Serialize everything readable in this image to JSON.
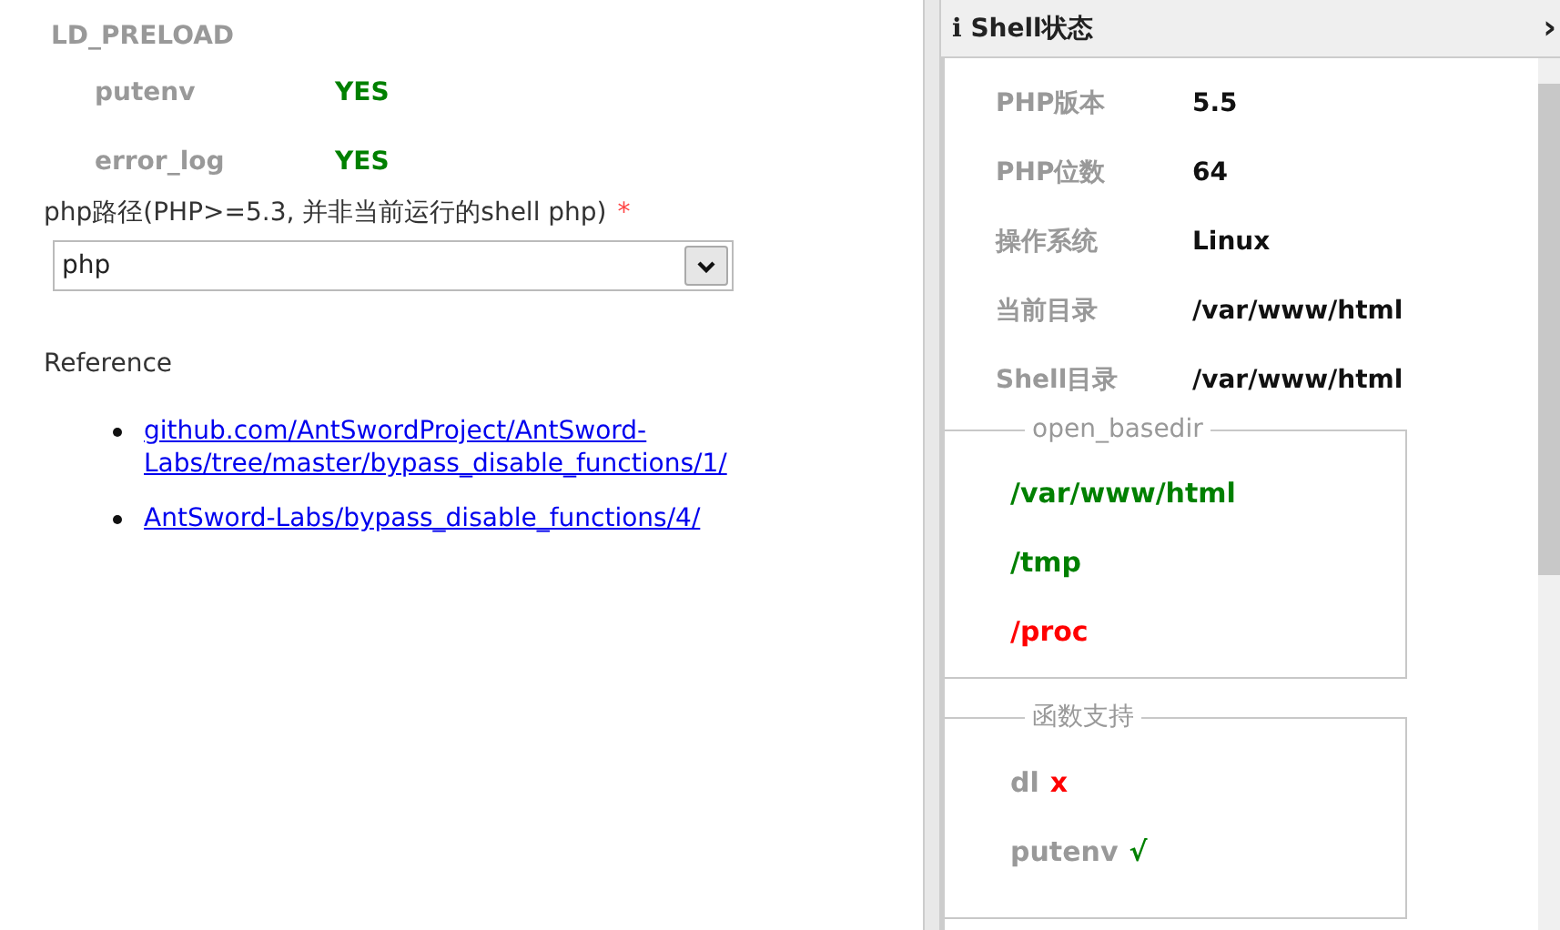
{
  "left": {
    "section_title": "LD_PRELOAD",
    "checks": [
      {
        "name": "putenv",
        "value": "YES",
        "ok": true
      },
      {
        "name": "error_log",
        "value": "YES",
        "ok": true
      }
    ],
    "php_path": {
      "label": "php路径(PHP>=5.3, 并非当前运行的shell php)",
      "required_mark": "*",
      "value": "php"
    },
    "reference": {
      "title": "Reference",
      "links": [
        "github.com/AntSwordProject/AntSword-Labs/tree/master/bypass_disable_functions/1/",
        "AntSword-Labs/bypass_disable_functions/4/"
      ]
    }
  },
  "panel": {
    "icon_text": "i",
    "title": "Shell状态",
    "collapse": "›",
    "info": [
      {
        "label": "PHP版本",
        "value": "5.5"
      },
      {
        "label": "PHP位数",
        "value": "64"
      },
      {
        "label": "操作系统",
        "value": "Linux"
      },
      {
        "label": "当前目录",
        "value": "/var/www/html"
      },
      {
        "label": "Shell目录",
        "value": "/var/www/html"
      }
    ],
    "open_basedir": {
      "legend": "open_basedir",
      "dirs": [
        {
          "path": "/var/www/html",
          "allowed": true
        },
        {
          "path": "/tmp",
          "allowed": true
        },
        {
          "path": "/proc",
          "allowed": false
        }
      ]
    },
    "functions": {
      "legend": "函数支持",
      "items": [
        {
          "name": "dl",
          "mark": "x",
          "supported": false
        },
        {
          "name": "putenv",
          "mark": "√",
          "supported": true
        }
      ]
    }
  }
}
